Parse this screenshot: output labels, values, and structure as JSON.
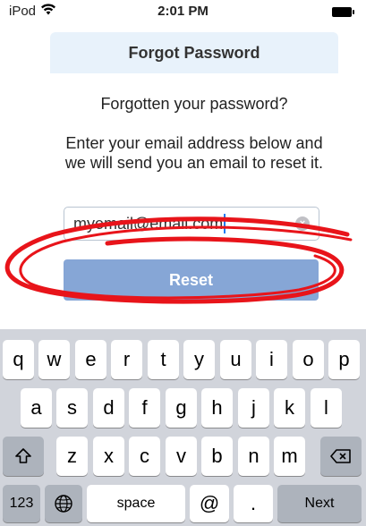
{
  "status_bar": {
    "device": "iPod",
    "time": "2:01 PM",
    "icons": [
      "wifi-icon",
      "battery-icon"
    ]
  },
  "form": {
    "title": "Forgot Password",
    "question": "Forgotten your password?",
    "instructions": "Enter your email address below and we will send you an email to reset it.",
    "email_value": "myemail@email.com",
    "reset_label": "Reset"
  },
  "keyboard": {
    "row1": [
      "q",
      "w",
      "e",
      "r",
      "t",
      "y",
      "u",
      "i",
      "o",
      "p"
    ],
    "row2": [
      "a",
      "s",
      "d",
      "f",
      "g",
      "h",
      "j",
      "k",
      "l"
    ],
    "row3": [
      "z",
      "x",
      "c",
      "v",
      "b",
      "n",
      "m"
    ],
    "numbers_label": "123",
    "space_label": "space",
    "at_label": "@",
    "dot_label": ".",
    "next_label": "Next"
  },
  "colors": {
    "header_bg": "#e8f2fb",
    "button_bg": "#86a6d6",
    "annotation_red": "#e8141a",
    "keyboard_bg": "#d1d4db"
  }
}
